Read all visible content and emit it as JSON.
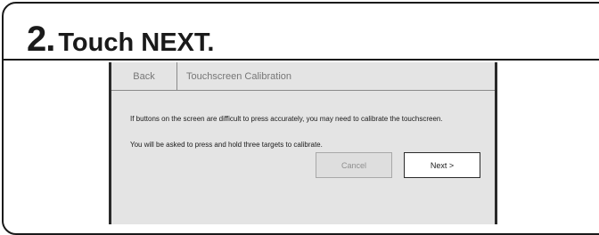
{
  "step": {
    "number": "2.",
    "instruction": "Touch NEXT."
  },
  "screen": {
    "back_label": "Back",
    "title": "Touchscreen Calibration",
    "message_1": "If buttons on the screen are difficult to press accurately, you may need to calibrate the touchscreen.",
    "message_2": "You will be asked to press and hold three targets to calibrate.",
    "cancel_label": "Cancel",
    "next_label": "Next >"
  }
}
